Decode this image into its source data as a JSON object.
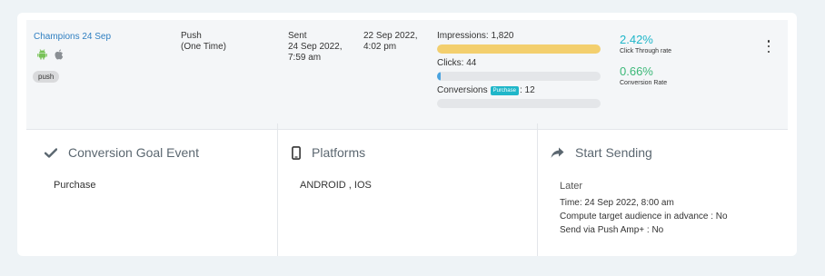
{
  "campaign": {
    "name": "Champions 24 Sep",
    "badge": "push",
    "platform_icons": [
      "android-icon",
      "apple-icon"
    ]
  },
  "type": {
    "line1": "Push",
    "line2": "(One Time)"
  },
  "sent": {
    "line1": "Sent",
    "line2": "24 Sep 2022,",
    "line3": "7:59 am"
  },
  "date": {
    "line1": "22 Sep 2022,",
    "line2": "4:02 pm"
  },
  "stats": {
    "impressions_label": "Impressions: 1,820",
    "impressions_fill": 1.0,
    "clicks_label": "Clicks: 44",
    "clicks_fill": 0.024,
    "conversions_prefix": "Conversions",
    "conversions_tag": "Purchase",
    "conversions_suffix": ": 12",
    "conversions_fill": 0.0
  },
  "rates": {
    "ctr_value": "2.42%",
    "ctr_label": "Click Through rate",
    "conv_value": "0.66%",
    "conv_label": "Conversion Rate"
  },
  "panels": {
    "goal": {
      "title": "Conversion Goal Event",
      "value": "Purchase"
    },
    "platforms": {
      "title": "Platforms",
      "value": "ANDROID , IOS"
    },
    "start": {
      "title": "Start Sending",
      "later": "Later",
      "time": "Time: 24 Sep 2022, 8:00 am",
      "compute": "Compute target audience in advance : No",
      "amp": "Send via Push Amp+ : No"
    }
  },
  "colors": {
    "link": "#2f7fc1",
    "impressions_bar": "#f3cf6e",
    "clicks_bar": "#4aa3df",
    "ctr": "#1fb6c9",
    "conversion": "#3cb878",
    "android": "#78c257",
    "apple": "#8a8f94",
    "tag": "#1fb6c9"
  }
}
